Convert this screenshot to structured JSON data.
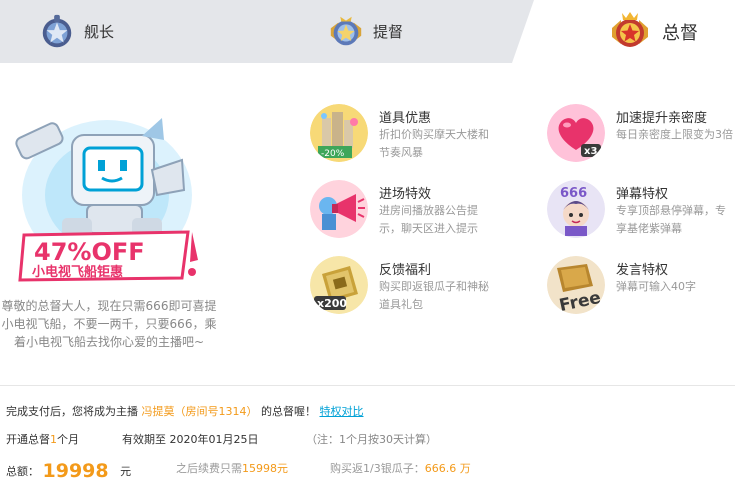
{
  "tabs": [
    {
      "label": "舰长"
    },
    {
      "label": "提督"
    },
    {
      "label": "总督"
    }
  ],
  "promo": {
    "badge_text": "47%OFF",
    "badge_sub": "小电视飞船钜惠",
    "description": "尊敬的总督大人，现在只需666即可喜提小电视飞船，不要一两千，只要666，乘着小电视飞船去找你心爱的主播吧~"
  },
  "perks": [
    {
      "title": "道具优惠",
      "desc": "折扣价购买摩天大楼和节奏风暴",
      "icon": "skyscraper-discount-icon",
      "tag": "-20%"
    },
    {
      "title": "加速提升亲密度",
      "desc": "每日亲密度上限变为3倍",
      "icon": "heart-x3-icon",
      "tag": "x3"
    },
    {
      "title": "进场特效",
      "desc": "进房间播放器公告提示，聊天区进入提示",
      "icon": "megaphone-icon"
    },
    {
      "title": "弹幕特权",
      "desc": "专享顶部悬停弹幕，专享基佬紫弹幕",
      "icon": "danmaku-666-icon",
      "tag": "666"
    },
    {
      "title": "反馈福利",
      "desc": "购买即返银瓜子和神秘道具礼包",
      "icon": "gift-box-x200-icon",
      "tag": "x200"
    },
    {
      "title": "发言特权",
      "desc": "弹幕可输入40字",
      "icon": "free-speech-icon",
      "tag": "Free"
    }
  ],
  "purchase": {
    "line1_prefix": "完成支付后，您将成为主播",
    "streamer": "冯提莫（房间号1314）",
    "line1_suffix": "的总督喔！",
    "compare_link": "特权对比",
    "duration_prefix": "开通总督",
    "duration_num": "1",
    "duration_suffix": "个月",
    "expiry_label": "有效期至",
    "expiry_date": "2020年01月25日",
    "note": "（注：1个月按30天计算）",
    "total_label": "总额：",
    "total_amount": "19998",
    "total_unit": "元",
    "renew_label": "之后续费只需",
    "renew_amount": "15998元",
    "rebate_label": "购买返1/3银瓜子：",
    "rebate_amount": "666.6 万"
  },
  "colors": {
    "accent": "#f39a1a",
    "link": "#00a1d6",
    "tab_inactive_bg": "#e4e6ea"
  }
}
